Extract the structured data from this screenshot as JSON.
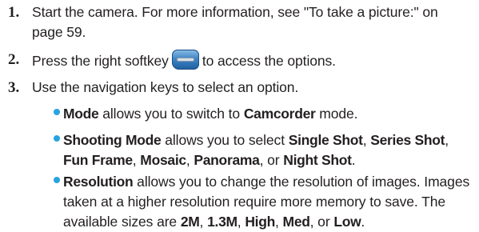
{
  "steps": [
    {
      "number": "1.",
      "text": "Start the camera. For more information, see \"To take a picture:\" on page 59."
    },
    {
      "number": "2.",
      "text_before": "Press the right softkey",
      "icon": "right-softkey-icon",
      "text_after": "to access the options."
    },
    {
      "number": "3.",
      "text": "Use the navigation keys to select an option."
    }
  ],
  "bullets": [
    {
      "parts": [
        {
          "t": "Mode",
          "b": true
        },
        {
          "t": " allows you to switch to ",
          "b": false
        },
        {
          "t": "Camcorder",
          "b": true
        },
        {
          "t": " mode.",
          "b": false
        }
      ]
    },
    {
      "parts": [
        {
          "t": "Shooting Mode",
          "b": true
        },
        {
          "t": " allows you to select ",
          "b": false
        },
        {
          "t": "Single Shot",
          "b": true
        },
        {
          "t": ", ",
          "b": false
        },
        {
          "t": "Series Shot",
          "b": true
        },
        {
          "t": ", ",
          "b": false
        },
        {
          "t": "Fun Frame",
          "b": true
        },
        {
          "t": ", ",
          "b": false
        },
        {
          "t": "Mosaic",
          "b": true
        },
        {
          "t": ", ",
          "b": false
        },
        {
          "t": "Panorama",
          "b": true
        },
        {
          "t": ", or ",
          "b": false
        },
        {
          "t": "Night Shot",
          "b": true
        },
        {
          "t": ".",
          "b": false
        }
      ]
    },
    {
      "parts": [
        {
          "t": "Resolution",
          "b": true
        },
        {
          "t": " allows you to change the resolution of images. Images taken at a higher resolution require more memory to save. The available sizes are ",
          "b": false
        },
        {
          "t": "2M",
          "b": true
        },
        {
          "t": ", ",
          "b": false
        },
        {
          "t": "1.3M",
          "b": true
        },
        {
          "t": ", ",
          "b": false
        },
        {
          "t": "High",
          "b": true
        },
        {
          "t": ", ",
          "b": false
        },
        {
          "t": "Med",
          "b": true
        },
        {
          "t": ", or ",
          "b": false
        },
        {
          "t": "Low",
          "b": true
        },
        {
          "t": ".",
          "b": false
        }
      ]
    }
  ],
  "colors": {
    "text": "#231f20",
    "bullet_dot": "#2aa3e0",
    "softkey_icon": "#3f85c6"
  }
}
